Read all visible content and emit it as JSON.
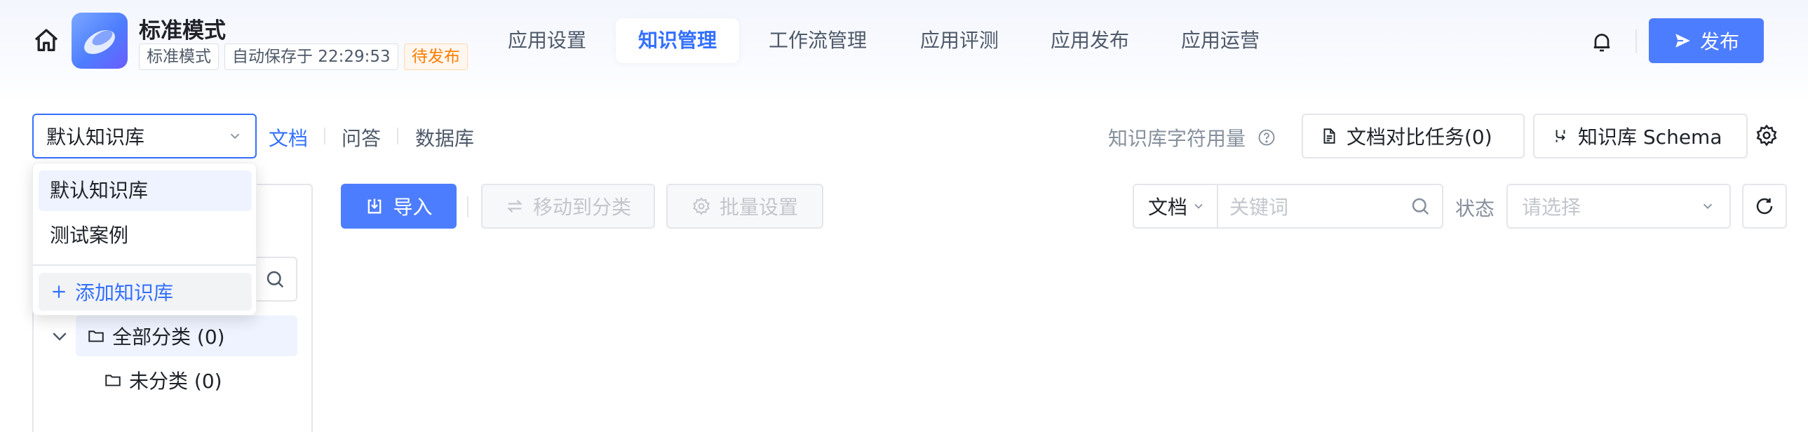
{
  "header": {
    "app_title": "标准模式",
    "tags": {
      "mode": "标准模式",
      "autosave": "自动保存于 22:29:53",
      "status": "待发布"
    },
    "nav_tabs": [
      {
        "label": "应用设置"
      },
      {
        "label": "知识管理"
      },
      {
        "label": "工作流管理"
      },
      {
        "label": "应用评测"
      },
      {
        "label": "应用发布"
      },
      {
        "label": "应用运营"
      }
    ],
    "active_tab": "知识管理",
    "publish_label": "发布"
  },
  "kb_bar": {
    "selected_kb": "默认知识库",
    "sub_tabs": [
      {
        "label": "文档"
      },
      {
        "label": "问答"
      },
      {
        "label": "数据库"
      }
    ],
    "char_usage_label": "知识库字符用量",
    "compare_task_label": "文档对比任务(0)",
    "schema_label": "知识库 Schema"
  },
  "toolbar": {
    "import_label": "导入",
    "move_label": "移动到分类",
    "batch_label": "批量设置",
    "filter_type": "文档",
    "keyword_placeholder": "关键词",
    "status_label": "状态",
    "status_placeholder": "请选择"
  },
  "tree": {
    "all_label": "全部分类 (0)",
    "uncategorized_label": "未分类 (0)"
  },
  "dropdown": {
    "items": [
      {
        "label": "默认知识库"
      },
      {
        "label": "测试案例"
      }
    ],
    "add_label": "添加知识库"
  },
  "colors": {
    "accent": "#3370ff",
    "primary_button": "#4d7dff",
    "warning": "#ff7d00"
  }
}
